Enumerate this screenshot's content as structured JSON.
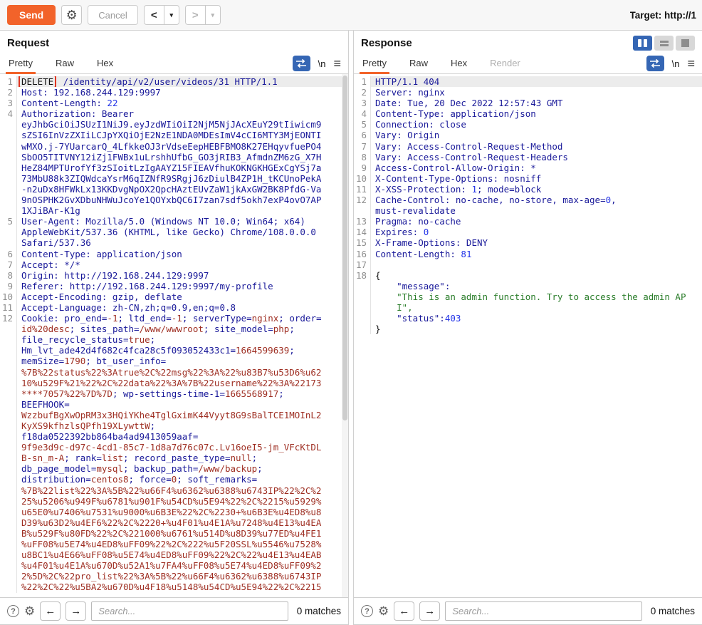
{
  "toolbar": {
    "send_label": "Send",
    "cancel_label": "Cancel",
    "target_label": "Target: http://1"
  },
  "icons": {
    "gear": "⚙",
    "back": "<",
    "forward": ">",
    "caret_down": "▾",
    "menu": "≡",
    "help": "?",
    "arrow_left": "←",
    "arrow_right": "→"
  },
  "colors": {
    "accent_orange": "#f2632a",
    "accent_blue": "#3566b4",
    "syntax_navy": "#181899",
    "syntax_red": "#9e2e22",
    "syntax_blue": "#2334e8",
    "syntax_green": "#2a7d2a",
    "selection_box_red": "#e0341f"
  },
  "request": {
    "title": "Request",
    "tabs": [
      {
        "label": "Pretty",
        "state": "active"
      },
      {
        "label": "Raw",
        "state": ""
      },
      {
        "label": "Hex",
        "state": ""
      }
    ],
    "newline_label": "\\n",
    "search_placeholder": "Search...",
    "matches_label": "0 matches",
    "lines": [
      {
        "n": "1",
        "hl": true,
        "p": [
          [
            "sel",
            "DELETE"
          ],
          [
            "k",
            " /identity/api/v2/user/videos/31 HTTP/1.1"
          ]
        ]
      },
      {
        "n": "2",
        "p": [
          [
            "k",
            "Host: 192.168.244.129:9997"
          ]
        ]
      },
      {
        "n": "3",
        "p": [
          [
            "k",
            "Content-Length: "
          ],
          [
            "n",
            "22"
          ]
        ]
      },
      {
        "n": "4",
        "p": [
          [
            "k",
            "Authorization: Bearer"
          ]
        ]
      },
      {
        "p": [
          [
            "k",
            "eyJhbGciOiJSUzI1NiJ9.eyJzdWIiOiI2NjM5NjJAcXEuY29tIiwicm9"
          ]
        ]
      },
      {
        "p": [
          [
            "k",
            "sZSI6InVzZXIiLCJpYXQiOjE2NzE1NDA0MDEsImV4cCI6MTY3MjEONTI"
          ]
        ]
      },
      {
        "p": [
          [
            "k",
            "wMXO.j-7YUarcarQ_4LfkkeOJ3rVdseEepHEBFBMO8K27EHqyvfuePO4"
          ]
        ]
      },
      {
        "p": [
          [
            "k",
            "SbOO5TITVNY12iZj1FWBx1uLrshhUfbG_GO3jRIB3_AfmdnZM6zG_X7H"
          ]
        ]
      },
      {
        "p": [
          [
            "k",
            "HeZ84MPTUrofYf3zSIoitLzIgAAYZ15FIEAVfhuKOKNGKHGExCgYSj7a"
          ]
        ]
      },
      {
        "p": [
          [
            "k",
            "73MbU88k3ZIQWdcaYsrM6qIZNfR9SRgjJ6zDiulB4ZP1H_tKCUnoPekA"
          ]
        ]
      },
      {
        "p": [
          [
            "k",
            "-n2uDx8HFWkLx13KKDvgNpOX2QpcHAztEUvZaW1jkAxGW2BK8PfdG-Va"
          ]
        ]
      },
      {
        "p": [
          [
            "k",
            "9nOSPHK2GvXDbuNHWuJcoYe1QOYxbQC6I7zan7sdf5okh7exP4ovO7AP"
          ]
        ]
      },
      {
        "p": [
          [
            "k",
            "1XJiBAr-K1g"
          ]
        ]
      },
      {
        "n": "5",
        "p": [
          [
            "k",
            "User-Agent: Mozilla/5.0 (Windows NT 10.0; Win64; x64)"
          ]
        ]
      },
      {
        "p": [
          [
            "k",
            "AppleWebKit/537.36 (KHTML, like Gecko) Chrome/108.0.0.0"
          ]
        ]
      },
      {
        "p": [
          [
            "k",
            "Safari/537.36"
          ]
        ]
      },
      {
        "n": "6",
        "p": [
          [
            "k",
            "Content-Type: application/json"
          ]
        ]
      },
      {
        "n": "7",
        "p": [
          [
            "k",
            "Accept: */*"
          ]
        ]
      },
      {
        "n": "8",
        "p": [
          [
            "k",
            "Origin: http://192.168.244.129:9997"
          ]
        ]
      },
      {
        "n": "9",
        "p": [
          [
            "k",
            "Referer: http://192.168.244.129:9997/my-profile"
          ]
        ]
      },
      {
        "n": "10",
        "p": [
          [
            "k",
            "Accept-Encoding: gzip, deflate"
          ]
        ]
      },
      {
        "n": "11",
        "p": [
          [
            "k",
            "Accept-Language: zh-CN,zh;q=0.9,en;q=0.8"
          ]
        ]
      },
      {
        "n": "12",
        "p": [
          [
            "k",
            "Cookie: pro_end="
          ],
          [
            "r",
            "-1"
          ],
          [
            "k",
            "; ltd_end="
          ],
          [
            "r",
            "-1"
          ],
          [
            "k",
            "; serverType="
          ],
          [
            "r",
            "nginx"
          ],
          [
            "k",
            "; order="
          ]
        ]
      },
      {
        "p": [
          [
            "r",
            "id%20desc"
          ],
          [
            "k",
            "; sites_path="
          ],
          [
            "r",
            "/www/wwwroot"
          ],
          [
            "k",
            "; site_model="
          ],
          [
            "r",
            "php"
          ],
          [
            "k",
            ";"
          ]
        ]
      },
      {
        "p": [
          [
            "k",
            "file_recycle_status="
          ],
          [
            "r",
            "true"
          ],
          [
            "k",
            ";"
          ]
        ]
      },
      {
        "p": [
          [
            "k",
            "Hm_lvt_ade42d4f682c4fca28c5f093052433c1="
          ],
          [
            "r",
            "1664599639"
          ],
          [
            "k",
            ";"
          ]
        ]
      },
      {
        "p": [
          [
            "k",
            "memSize="
          ],
          [
            "r",
            "1790"
          ],
          [
            "k",
            "; bt_user_info="
          ]
        ]
      },
      {
        "p": [
          [
            "r",
            "%7B%22status%22%3Atrue%2C%22msg%22%3A%22%u83B7%u53D6%u62"
          ]
        ]
      },
      {
        "p": [
          [
            "r",
            "10%u529F%21%22%2C%22data%22%3A%7B%22username%22%3A%22173"
          ]
        ]
      },
      {
        "p": [
          [
            "r",
            "****7057%22%7D%7D"
          ],
          [
            "k",
            "; wp-settings-time-1="
          ],
          [
            "r",
            "1665568917"
          ],
          [
            "k",
            ";"
          ]
        ]
      },
      {
        "p": [
          [
            "k",
            "BEEFHOOK="
          ]
        ]
      },
      {
        "p": [
          [
            "r",
            "WzzbufBgXwOpRM3x3HQiYKhe4TglGximK44Vyyt8G9sBalTCE1MOInL2"
          ]
        ]
      },
      {
        "p": [
          [
            "r",
            "KyXS9kfhzlsQPfh19XLywttW"
          ],
          [
            "k",
            ";"
          ]
        ]
      },
      {
        "p": [
          [
            "k",
            "f18da0522392bb864ba4ad9413059aaf="
          ]
        ]
      },
      {
        "p": [
          [
            "r",
            "9f9e3d9c-d97c-4cd1-85c7-1d8a7d76c07c.Lv16oeI5-jm_VFcKtDL"
          ]
        ]
      },
      {
        "p": [
          [
            "r",
            "B-sn_m-A"
          ],
          [
            "k",
            "; rank="
          ],
          [
            "r",
            "list"
          ],
          [
            "k",
            "; record_paste_type="
          ],
          [
            "r",
            "null"
          ],
          [
            "k",
            ";"
          ]
        ]
      },
      {
        "p": [
          [
            "k",
            "db_page_model="
          ],
          [
            "r",
            "mysql"
          ],
          [
            "k",
            "; backup_path="
          ],
          [
            "r",
            "/www/backup"
          ],
          [
            "k",
            ";"
          ]
        ]
      },
      {
        "p": [
          [
            "k",
            "distribution="
          ],
          [
            "r",
            "centos8"
          ],
          [
            "k",
            "; force="
          ],
          [
            "r",
            "0"
          ],
          [
            "k",
            "; soft_remarks="
          ]
        ]
      },
      {
        "p": [
          [
            "r",
            "%7B%22list%22%3A%5B%22%u66F4%u6362%u6388%u6743IP%22%2C%2"
          ]
        ]
      },
      {
        "p": [
          [
            "r",
            "25%u5206%u949F%u6781%u901F%u54CD%u5E94%22%2C%2215%u5929%"
          ]
        ]
      },
      {
        "p": [
          [
            "r",
            "u65E0%u7406%u7531%u9000%u6B3E%22%2C%2230+%u6B3E%u4ED8%u8"
          ]
        ]
      },
      {
        "p": [
          [
            "r",
            "D39%u63D2%u4EF6%22%2C%2220+%u4F01%u4E1A%u7248%u4E13%u4EA"
          ]
        ]
      },
      {
        "p": [
          [
            "r",
            "B%u529F%u80FD%22%2C%221000%u6761%u514D%u8D39%u77ED%u4FE1"
          ]
        ]
      },
      {
        "p": [
          [
            "r",
            "%uFF08%u5E74%u4ED8%uFF09%22%2C%222%u5F20SSL%u5546%u7528%"
          ]
        ]
      },
      {
        "p": [
          [
            "r",
            "u8BC1%u4E66%uFF08%u5E74%u4ED8%uFF09%22%2C%22%u4E13%u4EAB"
          ]
        ]
      },
      {
        "p": [
          [
            "r",
            "%u4F01%u4E1A%u670D%u52A1%u7FA4%uFF08%u5E74%u4ED8%uFF09%2"
          ]
        ]
      },
      {
        "p": [
          [
            "r",
            "2%5D%2C%22pro_list%22%3A%5B%22%u66F4%u6362%u6388%u6743IP"
          ]
        ]
      },
      {
        "p": [
          [
            "r",
            "%22%2C%22%u5BA2%u670D%u4F18%u5148%u54CD%u5E94%22%2C%2215"
          ]
        ]
      }
    ]
  },
  "response": {
    "title": "Response",
    "tabs": [
      {
        "label": "Pretty",
        "state": "active"
      },
      {
        "label": "Raw",
        "state": ""
      },
      {
        "label": "Hex",
        "state": ""
      },
      {
        "label": "Render",
        "state": "disabled"
      }
    ],
    "newline_label": "\\n",
    "search_placeholder": "Search...",
    "matches_label": "0 matches",
    "lines": [
      {
        "n": "1",
        "hl": true,
        "p": [
          [
            "k",
            "HTTP/1.1 404"
          ]
        ]
      },
      {
        "n": "2",
        "p": [
          [
            "k",
            "Server: nginx"
          ]
        ]
      },
      {
        "n": "3",
        "p": [
          [
            "k",
            "Date: Tue, 20 Dec 2022 12:57:43 GMT"
          ]
        ]
      },
      {
        "n": "4",
        "p": [
          [
            "k",
            "Content-Type: application/json"
          ]
        ]
      },
      {
        "n": "5",
        "p": [
          [
            "k",
            "Connection: close"
          ]
        ]
      },
      {
        "n": "6",
        "p": [
          [
            "k",
            "Vary: Origin"
          ]
        ]
      },
      {
        "n": "7",
        "p": [
          [
            "k",
            "Vary: Access-Control-Request-Method"
          ]
        ]
      },
      {
        "n": "8",
        "p": [
          [
            "k",
            "Vary: Access-Control-Request-Headers"
          ]
        ]
      },
      {
        "n": "9",
        "p": [
          [
            "k",
            "Access-Control-Allow-Origin: *"
          ]
        ]
      },
      {
        "n": "10",
        "p": [
          [
            "k",
            "X-Content-Type-Options: nosniff"
          ]
        ]
      },
      {
        "n": "11",
        "p": [
          [
            "k",
            "X-XSS-Protection: "
          ],
          [
            "n",
            "1"
          ],
          [
            "k",
            "; mode=block"
          ]
        ]
      },
      {
        "n": "12",
        "p": [
          [
            "k",
            "Cache-Control: no-cache, no-store, max-age="
          ],
          [
            "n",
            "0"
          ],
          [
            "k",
            ","
          ]
        ]
      },
      {
        "p": [
          [
            "k",
            "must-revalidate"
          ]
        ]
      },
      {
        "n": "13",
        "p": [
          [
            "k",
            "Pragma: no-cache"
          ]
        ]
      },
      {
        "n": "14",
        "p": [
          [
            "k",
            "Expires: "
          ],
          [
            "n",
            "0"
          ]
        ]
      },
      {
        "n": "15",
        "p": [
          [
            "k",
            "X-Frame-Options: DENY"
          ]
        ]
      },
      {
        "n": "16",
        "p": [
          [
            "k",
            "Content-Length: "
          ],
          [
            "n",
            "81"
          ]
        ]
      },
      {
        "n": "17",
        "p": []
      },
      {
        "n": "18",
        "p": [
          [
            "b",
            "{"
          ]
        ]
      },
      {
        "p": [
          [
            "k",
            "    \"message\":"
          ]
        ]
      },
      {
        "p": [
          [
            "g",
            "    \"This is an admin function. Try to access the admin AP"
          ]
        ]
      },
      {
        "p": [
          [
            "g",
            "    I\","
          ]
        ]
      },
      {
        "p": [
          [
            "k",
            "    \"status\":"
          ],
          [
            "n",
            "403"
          ]
        ]
      },
      {
        "p": [
          [
            "b",
            "}"
          ]
        ]
      }
    ]
  }
}
